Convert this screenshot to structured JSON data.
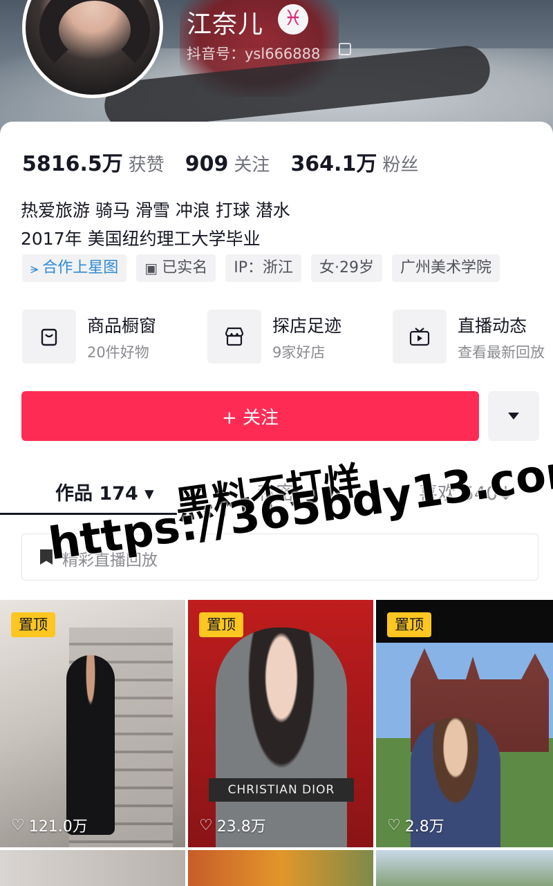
{
  "profile": {
    "name": "江奈儿",
    "zodiac_glyph": "♓",
    "douyin_id": "抖音号：ysl666888"
  },
  "stats": [
    {
      "value": "5816.5万",
      "label": "获赞"
    },
    {
      "value": "909",
      "label": "关注"
    },
    {
      "value": "364.1万",
      "label": "粉丝"
    }
  ],
  "bio": {
    "line1": "热爱旅游 骑马 滑雪 冲浪 打球 潜水",
    "line2": "2017年 美国纽约理工大学毕业"
  },
  "tags": [
    {
      "label": "合作上星图",
      "icon": "send-icon"
    },
    {
      "label": "已实名",
      "icon": "id-card-icon"
    },
    {
      "label": "IP：浙江"
    },
    {
      "label": "女·29岁"
    },
    {
      "label": "广州美术学院"
    }
  ],
  "features": [
    {
      "title": "商品橱窗",
      "subtitle": "20件好物",
      "icon": "shopping-bag-icon"
    },
    {
      "title": "探店足迹",
      "subtitle": "9家好店",
      "icon": "store-icon"
    },
    {
      "title": "直播动态",
      "subtitle": "查看最新回放",
      "icon": "tv-play-icon"
    }
  ],
  "actions": {
    "follow_label": "+ 关注"
  },
  "tabs": {
    "works_label": "作品 174",
    "second_label": "私密",
    "likes_label": "喜欢 540↓"
  },
  "collection_bar": {
    "text": "精彩直播回放"
  },
  "videos": [
    {
      "pinned": "置顶",
      "likes": "121.0万"
    },
    {
      "pinned": "置顶",
      "likes": "23.8万",
      "shirt_text": "CHRISTIAN DIOR"
    },
    {
      "pinned": "置顶",
      "likes": "2.8万"
    }
  ],
  "watermark": {
    "line1": "黑料不打烊",
    "line2": "https://365bdy13.com"
  },
  "colors": {
    "accent": "#fe2c55",
    "pin_badge": "#fdc620",
    "link_blue": "#2e8ad6"
  }
}
